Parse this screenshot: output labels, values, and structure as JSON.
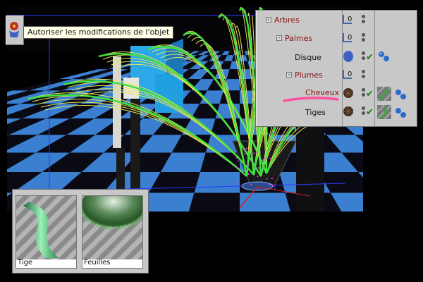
{
  "tooltip": {
    "text": "Autoriser les modifications de l'objet"
  },
  "toolbar": {
    "tool_icon": "object-modifier-icon"
  },
  "object_manager": {
    "rows": [
      {
        "name": "Arbres",
        "color": "#8a1010",
        "expander": "-",
        "has_check": false
      },
      {
        "name": "Palmes",
        "color": "#8a1010",
        "expander": "-",
        "has_check": false
      },
      {
        "name": "Disque",
        "color": "#111111",
        "expander": "",
        "has_check": true,
        "tag": "material-sphere-tag-icon"
      },
      {
        "name": "Plumes",
        "color": "#8a1010",
        "expander": "-",
        "has_check": false
      },
      {
        "name": "Cheveux",
        "color": "#8a1010",
        "expander": "",
        "has_check": true,
        "tag": "hair-material-tag-icon"
      },
      {
        "name": "Tiges",
        "color": "#111111",
        "expander": "",
        "has_check": true,
        "tag": "hair-material-tag-icon"
      }
    ],
    "layer_badge": "0",
    "check_symbol": "✔"
  },
  "materials": [
    {
      "name": "Tige",
      "icon": "stem-material-preview"
    },
    {
      "name": "Feuilles",
      "icon": "leaves-material-preview"
    }
  ],
  "colors": {
    "highlight_stroke": "#ff4fa0",
    "hair_yellow": "#e8e850",
    "hair_green": "#40e040",
    "floor_blue": "#3a7fd0"
  }
}
